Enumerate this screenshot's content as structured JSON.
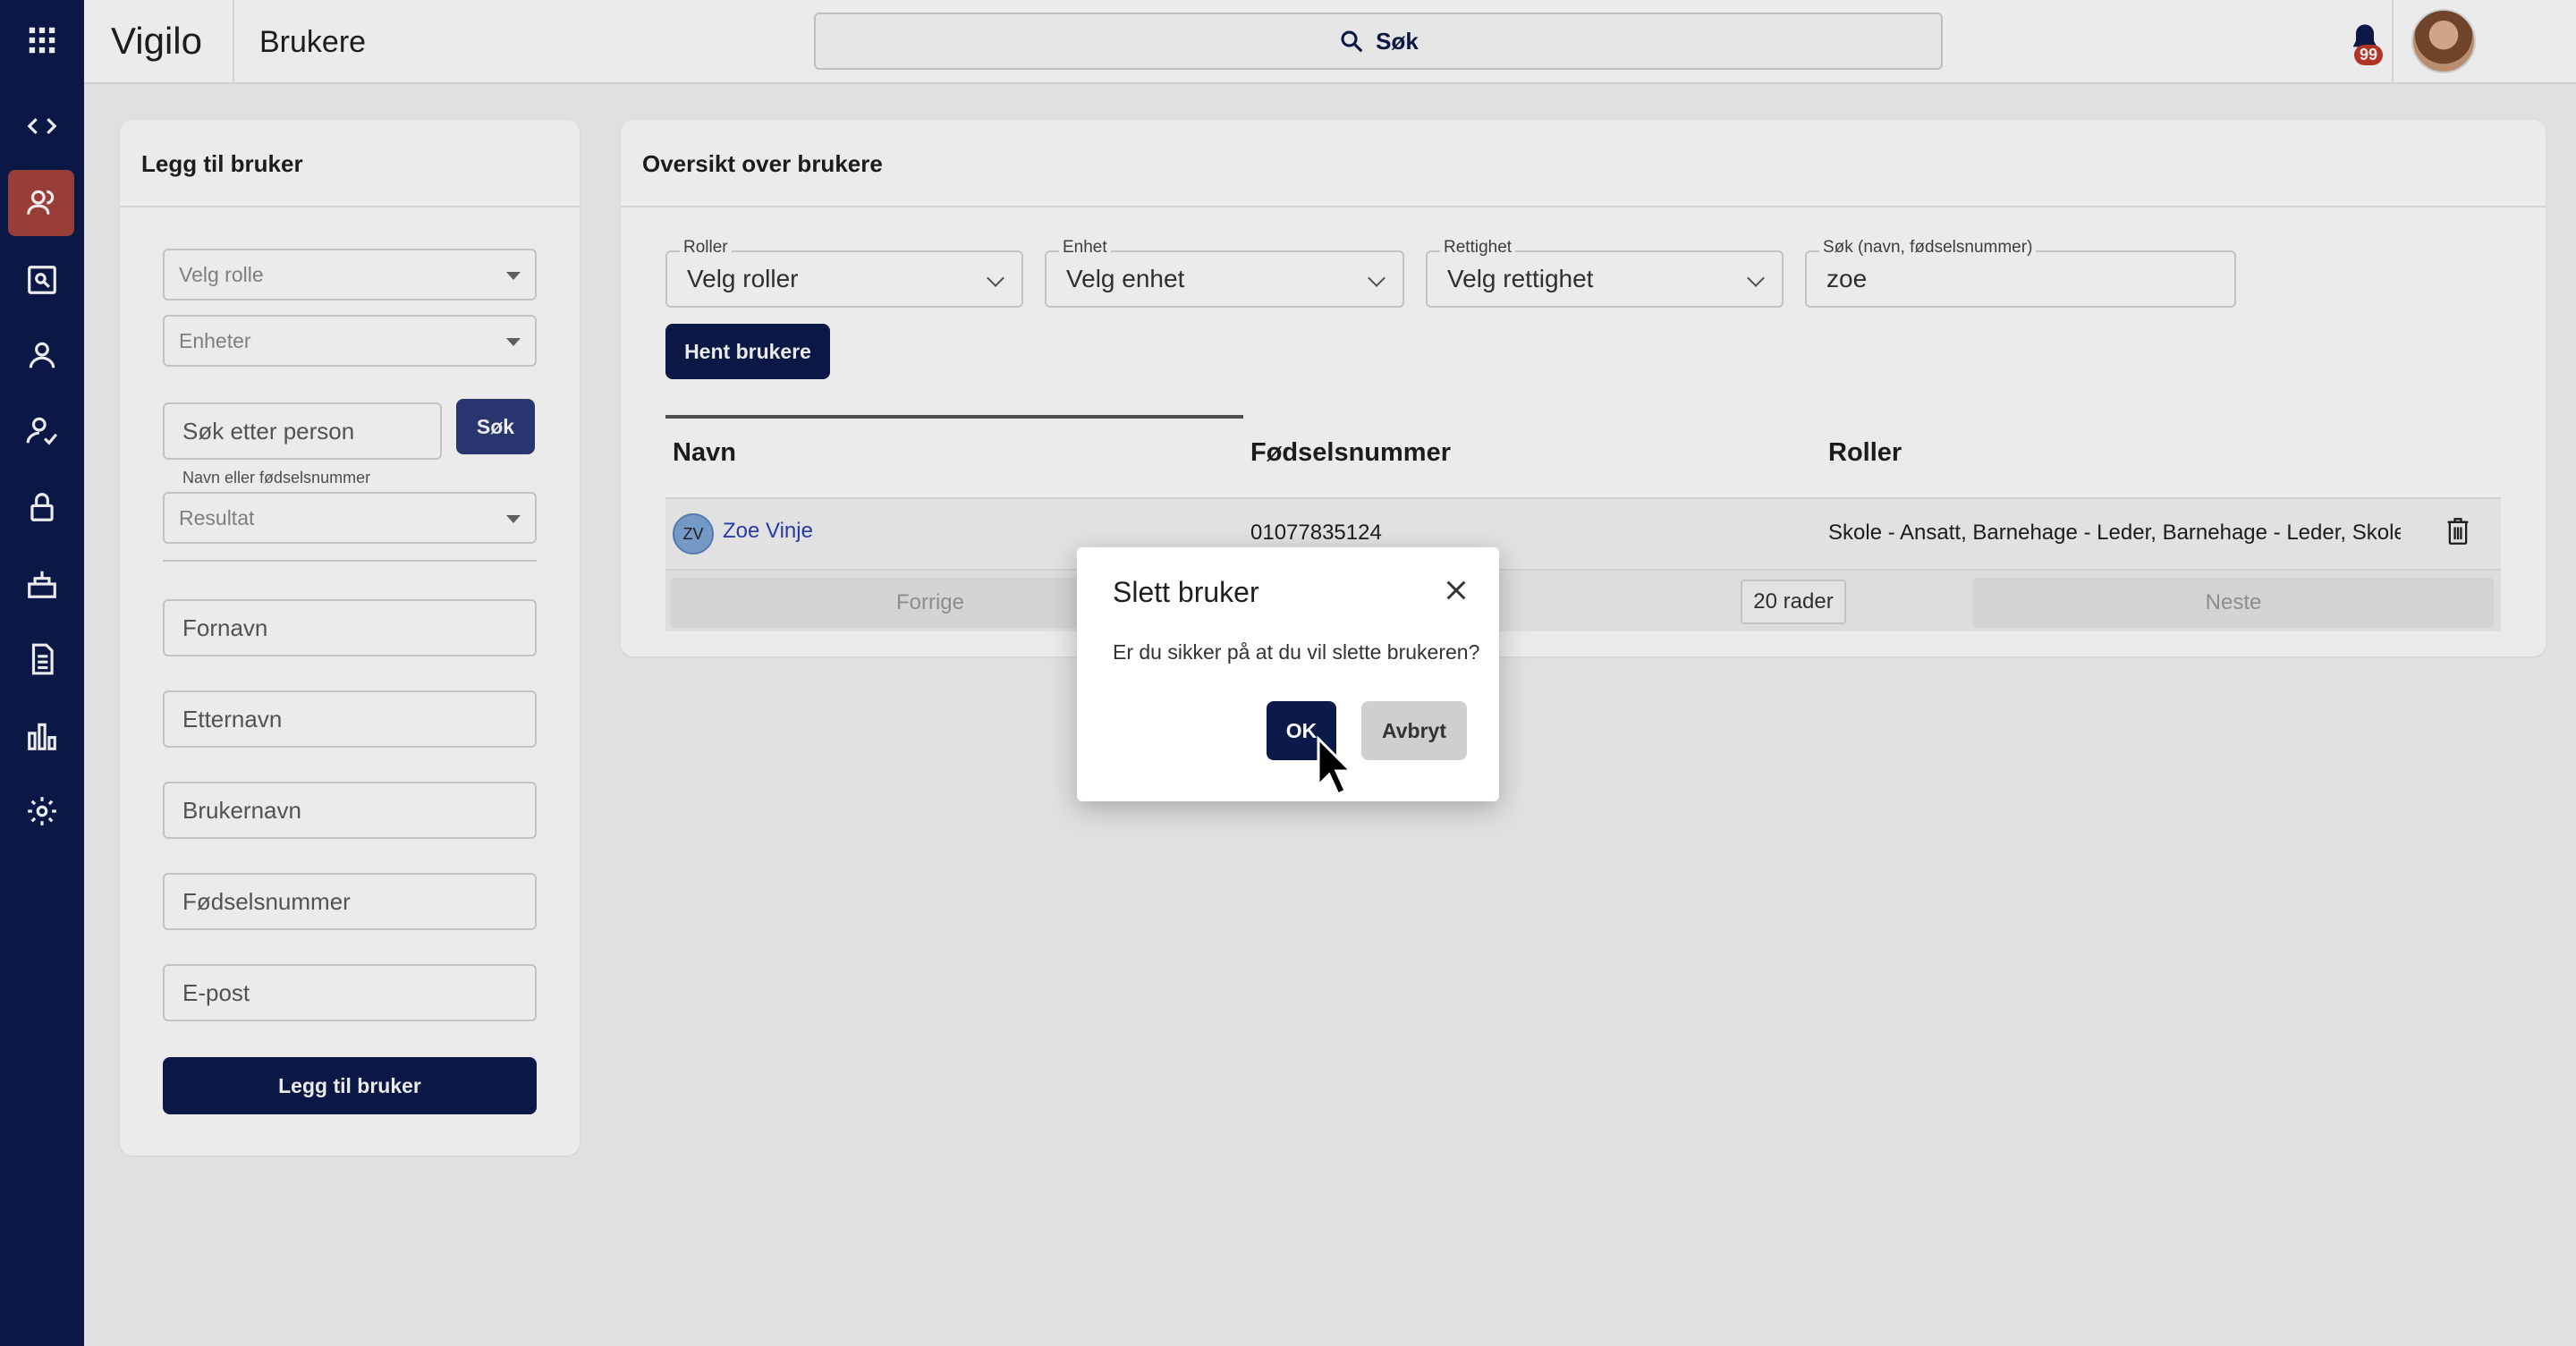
{
  "app": {
    "logo": "Vigilo",
    "page_title": "Brukere"
  },
  "header": {
    "search_label": "Søk",
    "notification_count": "99"
  },
  "sidebar": {
    "items": [
      {
        "icon": "grid-icon"
      },
      {
        "icon": "code-icon"
      },
      {
        "icon": "users-icon",
        "active": true
      },
      {
        "icon": "search-user-icon"
      },
      {
        "icon": "person-icon"
      },
      {
        "icon": "person-check-icon"
      },
      {
        "icon": "lock-icon"
      },
      {
        "icon": "building-icon"
      },
      {
        "icon": "document-icon"
      },
      {
        "icon": "bar-chart-icon"
      },
      {
        "icon": "gear-icon"
      }
    ]
  },
  "add_user": {
    "title": "Legg til bruker",
    "role_placeholder": "Velg rolle",
    "units_placeholder": "Enheter",
    "person_search_placeholder": "Søk etter person",
    "search_button": "Søk",
    "search_hint": "Navn eller fødselsnummer",
    "result_placeholder": "Resultat",
    "firstname_placeholder": "Fornavn",
    "lastname_placeholder": "Etternavn",
    "username_placeholder": "Brukernavn",
    "ssn_placeholder": "Fødselsnummer",
    "email_placeholder": "E-post",
    "submit_button": "Legg til bruker"
  },
  "overview": {
    "title": "Oversikt over brukere",
    "filters": {
      "roles_label": "Roller",
      "roles_value": "Velg roller",
      "unit_label": "Enhet",
      "unit_value": "Velg enhet",
      "permission_label": "Rettighet",
      "permission_value": "Velg rettighet",
      "search_label": "Søk (navn, fødselsnummer)",
      "search_value": "zoe"
    },
    "fetch_button": "Hent brukere",
    "columns": {
      "name": "Navn",
      "ssn": "Fødselsnummer",
      "roles": "Roller"
    },
    "rows": [
      {
        "initials": "ZV",
        "name": "Zoe Vinje",
        "ssn": "01077835124",
        "roles": "Skole - Ansatt, Barnehage - Leder, Barnehage - Leder, Skole - Ansatt"
      }
    ],
    "pager": {
      "prev": "Forrige",
      "rows_per_page": "20 rader",
      "next": "Neste"
    }
  },
  "dialog": {
    "title": "Slett bruker",
    "message": "Er du sikker på at du vil slette brukeren?",
    "ok": "OK",
    "cancel": "Avbryt"
  },
  "colors": {
    "sidebar": "#0c1a4b",
    "active": "#a6433d",
    "primary": "#0c1a4b",
    "link": "#2b3fb8"
  }
}
